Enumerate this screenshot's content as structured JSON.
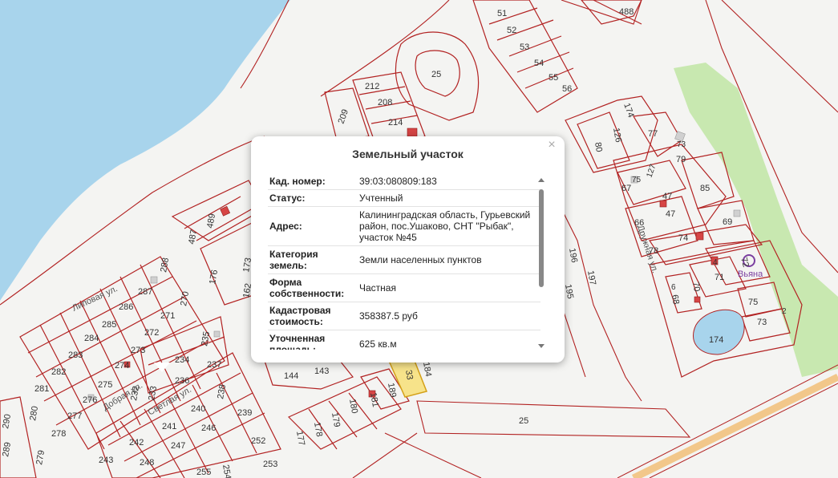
{
  "popup": {
    "title": "Земельный участок",
    "close": "×",
    "rows": [
      {
        "key": "Кад. номер:",
        "value": "39:03:080809:183"
      },
      {
        "key": "Статус:",
        "value": "Учтенный"
      },
      {
        "key": "Адрес:",
        "value": "Калининградская область, Гурьевский район, пос.Ушаково, СНТ \"Рыбак\", участок №45"
      },
      {
        "key": "Категория земель:",
        "value": "Земли населенных пунктов"
      },
      {
        "key": "Форма собственности:",
        "value": "Частная"
      },
      {
        "key": "Кадастровая стоимость:",
        "value": "358387.5 руб"
      },
      {
        "key": "Уточненная площадь:",
        "value": "625 кв.м"
      }
    ]
  },
  "map": {
    "streets": {
      "lipovaya": "Липовая ул.",
      "dobraya": "Добрая ул.",
      "svetlaya": "Светлая ул.",
      "druzhnaya": "Дружная ул."
    },
    "poi": "Вьяна",
    "plots": {
      "p488": "488",
      "p51": "51",
      "p52": "52",
      "p53": "53",
      "p54": "54",
      "p55": "55",
      "p56": "56",
      "p25a": "25",
      "p212": "212",
      "p208": "208",
      "p214": "214",
      "p209": "209",
      "p174a": "174",
      "p126": "126",
      "p80": "80",
      "p77": "77",
      "p73a": "73",
      "p79": "79",
      "p67": "67",
      "p127": "127",
      "p75a": "75",
      "p85": "85",
      "p47a": "47",
      "p47b": "47",
      "p66": "66",
      "p69": "69",
      "p74": "74",
      "p78": "78",
      "p72": "72",
      "p71": "71",
      "p4": "4",
      "p70": "70",
      "p68": "68",
      "p6": "6",
      "p75b": "75",
      "p73b": "73",
      "p2": "2",
      "p174b": "174",
      "p489": "489",
      "p487": "487",
      "p176": "176",
      "p173": "173",
      "p162": "162",
      "p196": "196",
      "p197": "197",
      "p195": "195",
      "p288": "288",
      "p287": "287",
      "p270": "270",
      "p286": "286",
      "p271": "271",
      "p285": "285",
      "p272": "272",
      "p284": "284",
      "p273": "273",
      "p283": "283",
      "p274": "274",
      "p282": "282",
      "p275": "275",
      "p281": "281",
      "p276": "276",
      "p277": "277",
      "p280": "280",
      "p278": "278",
      "p279": "279",
      "p290": "290",
      "p289": "289",
      "p235": "235",
      "p234": "234",
      "p237": "237",
      "p236": "236",
      "p232": "232",
      "p233": "233",
      "p238": "238",
      "p240": "240",
      "p239": "239",
      "p241": "241",
      "p246": "246",
      "p242": "242",
      "p247": "247",
      "p243": "243",
      "p248": "248",
      "p252": "252",
      "p253": "253",
      "p254": "254",
      "p255": "255",
      "p144": "144",
      "p143": "143",
      "p181": "181",
      "p180": "180",
      "p189": "189",
      "p179": "179",
      "p178": "178",
      "p177": "177",
      "p25b": "25",
      "p33": "33",
      "p184": "184"
    }
  }
}
